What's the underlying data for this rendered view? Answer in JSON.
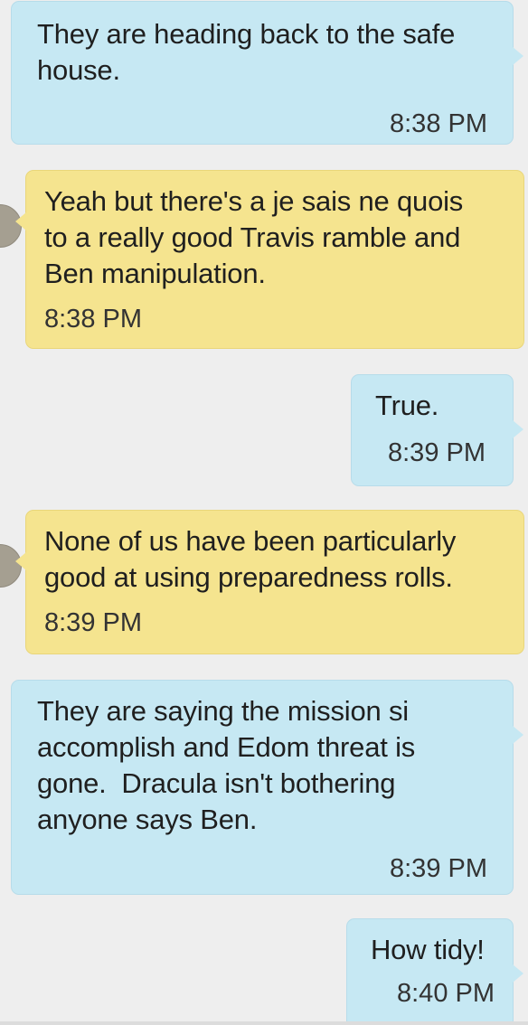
{
  "messages": [
    {
      "direction": "outgoing",
      "text": "They are heading back to the safe\nhouse.",
      "time": "8:38 PM"
    },
    {
      "direction": "incoming",
      "text": "Yeah but there's a je sais ne quois\nto a really good Travis ramble and\nBen manipulation.",
      "time": "8:38 PM"
    },
    {
      "direction": "outgoing",
      "text": "True.",
      "time": "8:39 PM"
    },
    {
      "direction": "incoming",
      "text": "None of us have been particularly\ngood at using preparedness rolls.",
      "time": "8:39 PM"
    },
    {
      "direction": "outgoing",
      "text": "They are saying the mission si\naccomplish and Edom threat is\ngone.  Dracula isn't bothering\nanyone says Ben.",
      "time": "8:39 PM"
    },
    {
      "direction": "outgoing",
      "text": "How tidy!",
      "time": "8:40 PM"
    }
  ],
  "colors": {
    "background": "#eeeeee",
    "outgoing_bubble": "#c6e8f3",
    "incoming_bubble": "#f5e48f",
    "text": "#1f1f1f",
    "timestamp": "#333333"
  },
  "icons": {
    "avatar": "contact-avatar-icon"
  }
}
